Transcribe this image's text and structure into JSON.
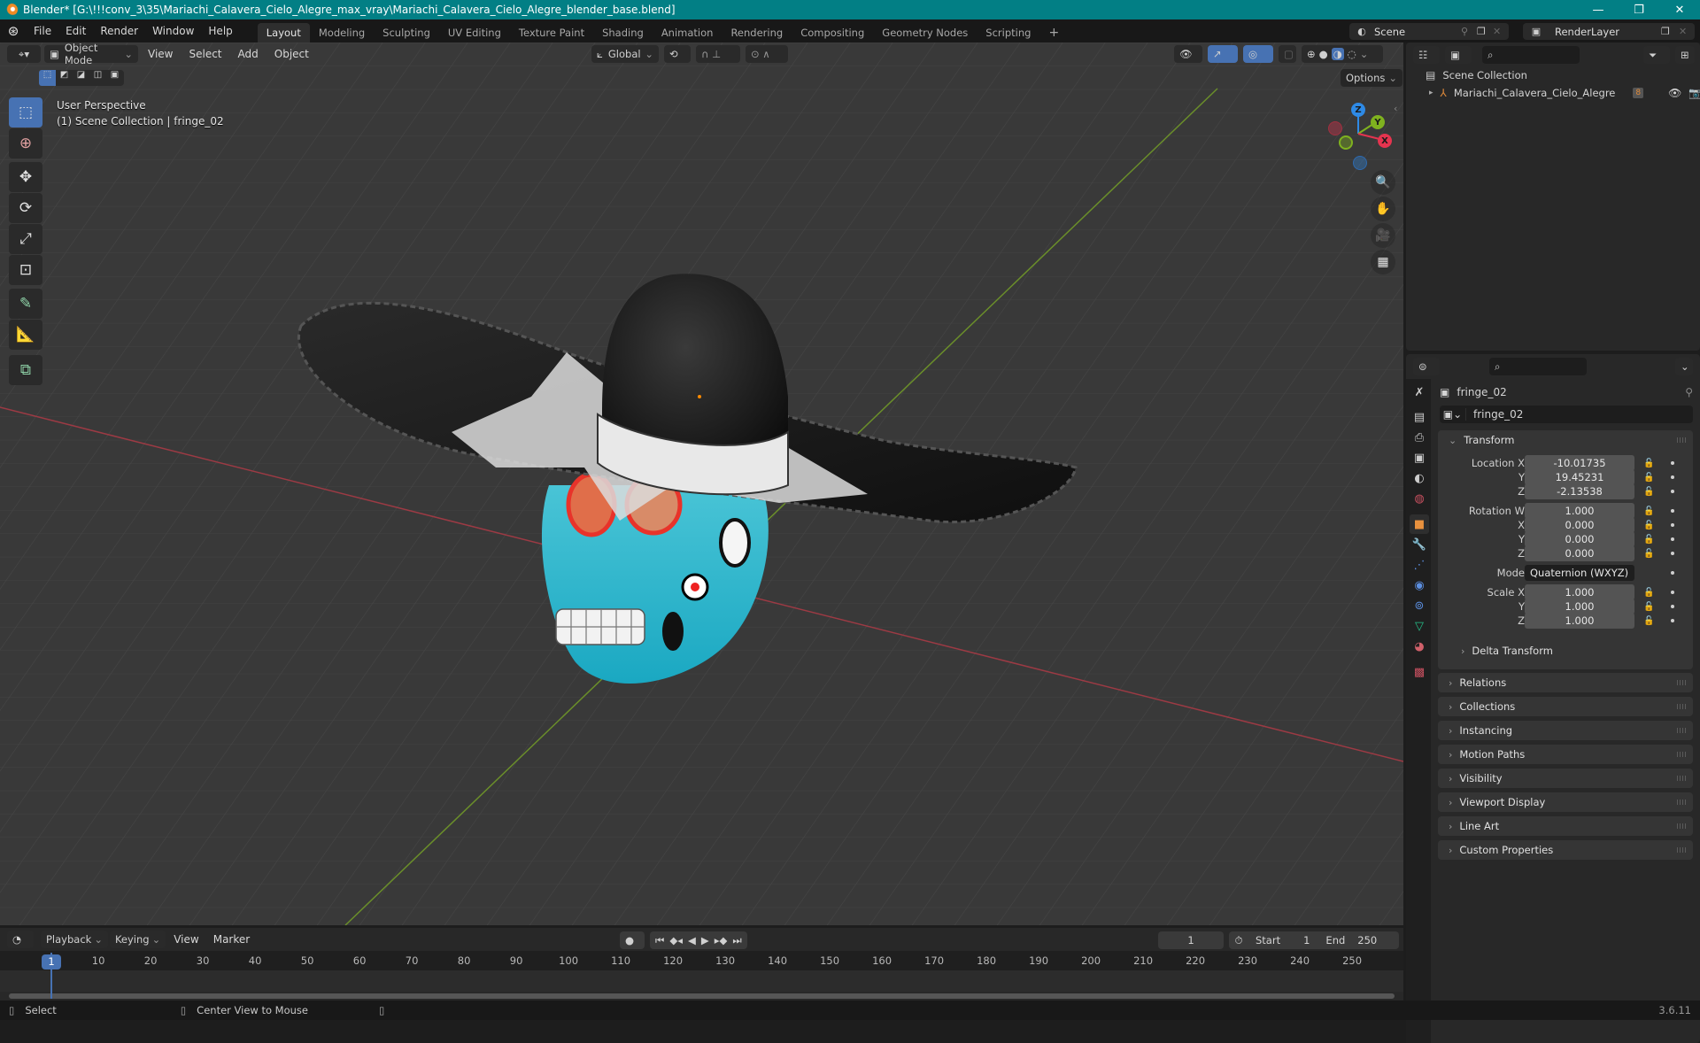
{
  "window": {
    "title": "Blender* [G:\\!!!conv_3\\35\\Mariachi_Calavera_Cielo_Alegre_max_vray\\Mariachi_Calavera_Cielo_Alegre_blender_base.blend]",
    "controls": {
      "minimize": "—",
      "maximize": "❐",
      "close": "✕"
    }
  },
  "menubar": {
    "items": [
      "File",
      "Edit",
      "Render",
      "Window",
      "Help"
    ],
    "workspaces": [
      "Layout",
      "Modeling",
      "Sculpting",
      "UV Editing",
      "Texture Paint",
      "Shading",
      "Animation",
      "Rendering",
      "Compositing",
      "Geometry Nodes",
      "Scripting"
    ],
    "active_workspace": "Layout",
    "add_workspace": "+",
    "scene": "Scene",
    "view_layer": "RenderLayer"
  },
  "viewport": {
    "mode": "Object Mode",
    "menus": [
      "View",
      "Select",
      "Add",
      "Object"
    ],
    "transform_orientation": "Global",
    "options_label": "Options",
    "overlay_line1": "User Perspective",
    "overlay_line2": "(1) Scene Collection | fringe_02",
    "gizmo_axes": {
      "x": "X",
      "y": "Y",
      "z": "Z"
    },
    "colors": {
      "x_axis": "#e5344f",
      "y_axis": "#7fb21f",
      "z_axis": "#2e8ae6",
      "active": "#4772b3"
    },
    "tools": [
      "select-box",
      "cursor",
      "move",
      "rotate",
      "scale",
      "transform",
      "annotate",
      "measure",
      "add-cube"
    ],
    "nav_buttons": [
      "zoom",
      "pan",
      "camera",
      "ortho-grid"
    ]
  },
  "outliner": {
    "search_placeholder": "",
    "root": "Scene Collection",
    "items": [
      {
        "name": "Mariachi_Calavera_Cielo_Alegre",
        "badge": "8"
      }
    ]
  },
  "properties": {
    "object_name": "fringe_02",
    "datablock_name": "fringe_02",
    "transform_title": "Transform",
    "location": {
      "label": "Location X",
      "x": "-10.01735",
      "y": "19.45231",
      "z": "-2.13538"
    },
    "rotation": {
      "label": "Rotation W",
      "w": "1.000",
      "x": "0.000",
      "y": "0.000",
      "z": "0.000"
    },
    "mode_label": "Mode",
    "mode_value": "Quaternion (WXYZ)",
    "scale": {
      "label": "Scale X",
      "x": "1.000",
      "y": "1.000",
      "z": "1.000"
    },
    "axis_labels": {
      "y": "Y",
      "z": "Z",
      "x": "X"
    },
    "delta_transform": "Delta Transform",
    "panels": [
      "Relations",
      "Collections",
      "Instancing",
      "Motion Paths",
      "Visibility",
      "Viewport Display",
      "Line Art",
      "Custom Properties"
    ]
  },
  "timeline": {
    "menus": [
      "Playback",
      "Keying",
      "View",
      "Marker"
    ],
    "current_frame": "1",
    "start_label": "Start",
    "start": "1",
    "end_label": "End",
    "end": "250",
    "ruler": [
      "1",
      "10",
      "20",
      "30",
      "40",
      "50",
      "60",
      "70",
      "80",
      "90",
      "100",
      "110",
      "120",
      "130",
      "140",
      "150",
      "160",
      "170",
      "180",
      "190",
      "200",
      "210",
      "220",
      "230",
      "240",
      "250"
    ]
  },
  "statusbar": {
    "select": "Select",
    "center_view": "Center View to Mouse",
    "version": "3.6.11"
  }
}
